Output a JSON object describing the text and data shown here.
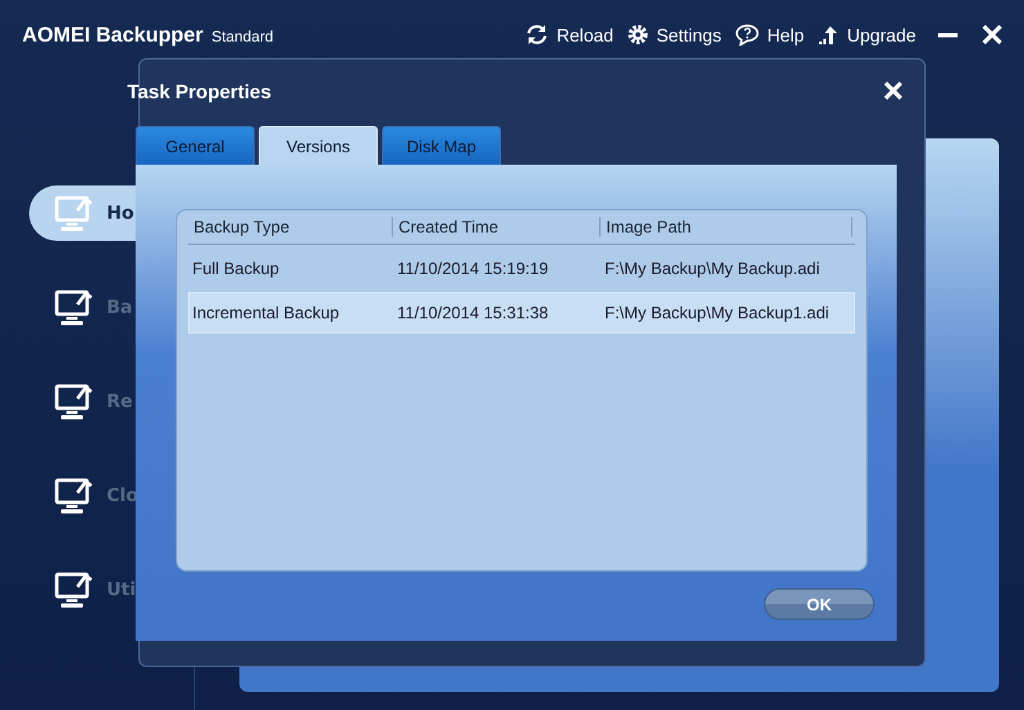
{
  "app": {
    "title": "AOMEI Backupper",
    "edition": "Standard"
  },
  "toolbar": [
    {
      "label": "Reload",
      "kind": "reload"
    },
    {
      "label": "Settings",
      "kind": "settings"
    },
    {
      "label": "Help",
      "kind": "help"
    },
    {
      "label": "Upgrade",
      "kind": "upgrade"
    }
  ],
  "sidebar": {
    "items": [
      {
        "label": "Ho",
        "selected": true
      },
      {
        "label": "Ba",
        "selected": false
      },
      {
        "label": "Re",
        "selected": false
      },
      {
        "label": "Clo",
        "selected": false
      },
      {
        "label": "Uti",
        "selected": false
      }
    ]
  },
  "dialog": {
    "title": "Task Properties",
    "tabs": [
      {
        "label": "General",
        "selected": false
      },
      {
        "label": "Versions",
        "selected": true
      },
      {
        "label": "Disk Map",
        "selected": false
      }
    ],
    "table": {
      "columns": [
        "Backup Type",
        "Created Time",
        "Image Path"
      ],
      "rows": [
        {
          "cells": [
            "Full Backup",
            "11/10/2014 15:19:19",
            "F:\\My Backup\\My Backup.adi"
          ],
          "selected": false
        },
        {
          "cells": [
            "Incremental Backup",
            "11/10/2014 15:31:38",
            "F:\\My Backup\\My Backup1.adi"
          ],
          "selected": true
        }
      ]
    },
    "ok_button": "OK"
  }
}
